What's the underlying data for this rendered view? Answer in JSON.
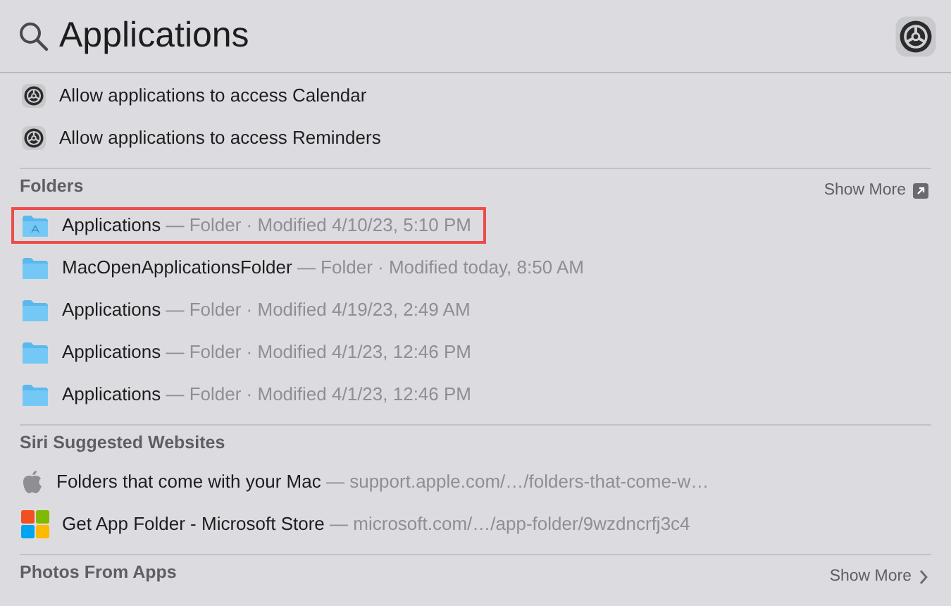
{
  "search": {
    "value": "Applications"
  },
  "top_hits": [
    {
      "kind": "settings",
      "text": "Allow applications to access Calendar"
    },
    {
      "kind": "settings",
      "text": "Allow applications to access Reminders"
    }
  ],
  "sections": [
    {
      "title": "Folders",
      "show_more": {
        "label": "Show More",
        "kind": "open"
      },
      "items": [
        {
          "kind": "app-folder",
          "name": "Applications",
          "detail": "— Folder · Modified 4/10/23, 5:10 PM",
          "selected": true
        },
        {
          "kind": "folder",
          "name": "MacOpenApplicationsFolder",
          "detail": "— Folder · Modified today, 8:50 AM",
          "selected": false
        },
        {
          "kind": "folder",
          "name": "Applications",
          "detail": "— Folder · Modified 4/19/23, 2:49 AM",
          "selected": false
        },
        {
          "kind": "folder",
          "name": "Applications",
          "detail": "— Folder · Modified 4/1/23, 12:46 PM",
          "selected": false
        },
        {
          "kind": "folder",
          "name": "Applications",
          "detail": "— Folder · Modified 4/1/23, 12:46 PM",
          "selected": false
        }
      ]
    },
    {
      "title": "Siri Suggested Websites",
      "items": [
        {
          "kind": "apple",
          "name": "Folders that come with your Mac",
          "detail": "— support.apple.com/…/folders-that-come-w…",
          "selected": false
        },
        {
          "kind": "windows",
          "name": "Get App Folder - Microsoft Store",
          "detail": "— microsoft.com/…/app-folder/9wzdncrfj3c4",
          "selected": false
        }
      ]
    },
    {
      "title": "Photos From Apps",
      "show_more": {
        "label": "Show More",
        "kind": "chevron"
      }
    }
  ]
}
